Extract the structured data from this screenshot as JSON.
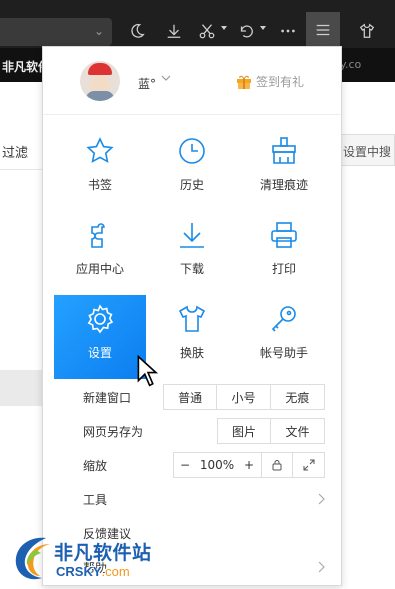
{
  "browser": {
    "bookmark_text": "非凡软件",
    "bookmark_right_text": "y.co",
    "page_left_text": "过滤",
    "page_right_text": "设置中搜",
    "toolbar_icons": [
      "moon-icon",
      "download-icon",
      "scissors-icon",
      "undo-icon",
      "more-icon",
      "menu-icon",
      "shirt-icon"
    ]
  },
  "menu": {
    "user": {
      "name": "蓝°",
      "checkin_label": "签到有礼"
    },
    "tiles": [
      {
        "label": "书签",
        "icon": "star-icon"
      },
      {
        "label": "历史",
        "icon": "clock-icon"
      },
      {
        "label": "清理痕迹",
        "icon": "broom-icon"
      },
      {
        "label": "应用中心",
        "icon": "puzzle-icon"
      },
      {
        "label": "下载",
        "icon": "download-icon"
      },
      {
        "label": "打印",
        "icon": "printer-icon"
      },
      {
        "label": "设置",
        "icon": "gear-icon",
        "selected": true
      },
      {
        "label": "换肤",
        "icon": "shirt-icon"
      },
      {
        "label": "帐号助手",
        "icon": "key-icon"
      }
    ],
    "new_window": {
      "label": "新建窗口",
      "options": [
        "普通",
        "小号",
        "无痕"
      ]
    },
    "save_as": {
      "label": "网页另存为",
      "options": [
        "图片",
        "文件"
      ]
    },
    "zoom": {
      "label": "缩放",
      "minus": "−",
      "value": "100%",
      "plus": "+"
    },
    "tools_label": "工具",
    "feedback_label": "反馈建议",
    "help_label": "帮助"
  },
  "watermark": {
    "cn": "非凡软件站",
    "en_main": "CRSKY",
    "en_suffix": ".com"
  },
  "colors": {
    "accent": "#1a8be6",
    "selected_tile": "#1890ff",
    "chrome": "#1f1f1f"
  }
}
